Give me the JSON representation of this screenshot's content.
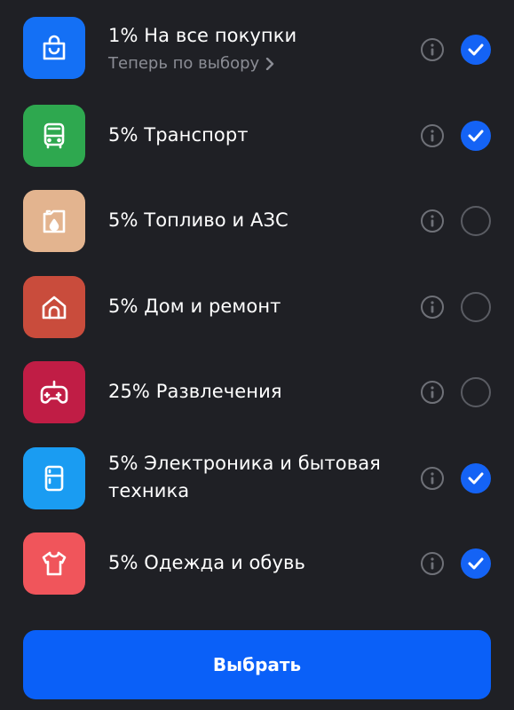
{
  "colors": {
    "background": "#1f2025",
    "accent": "#1463f5",
    "button": "#0a60f8"
  },
  "categories": [
    {
      "label": "1% На все покупки",
      "subtitle": "Теперь по выбору",
      "icon": "shopping-bag-icon",
      "color": "#1470f5",
      "selected": true
    },
    {
      "label": "5% Транспорт",
      "icon": "bus-icon",
      "color": "#2ea84f",
      "selected": true
    },
    {
      "label": "5% Топливо и АЗС",
      "icon": "fuel-canister-icon",
      "color": "#e3b48f",
      "selected": false
    },
    {
      "label": "5% Дом и ремонт",
      "icon": "house-icon",
      "color": "#c94c3c",
      "selected": false
    },
    {
      "label": "25% Развлечения",
      "icon": "gamepad-icon",
      "color": "#c01d45",
      "selected": false
    },
    {
      "label_line1": "5% Электроника и бытовая",
      "label_line2": "техника",
      "icon": "fridge-icon",
      "color": "#1a9cf2",
      "selected": true
    },
    {
      "label": "5% Одежда и обувь",
      "icon": "tshirt-icon",
      "color": "#f0555b",
      "selected": true
    }
  ],
  "cta": {
    "label": "Выбрать"
  }
}
